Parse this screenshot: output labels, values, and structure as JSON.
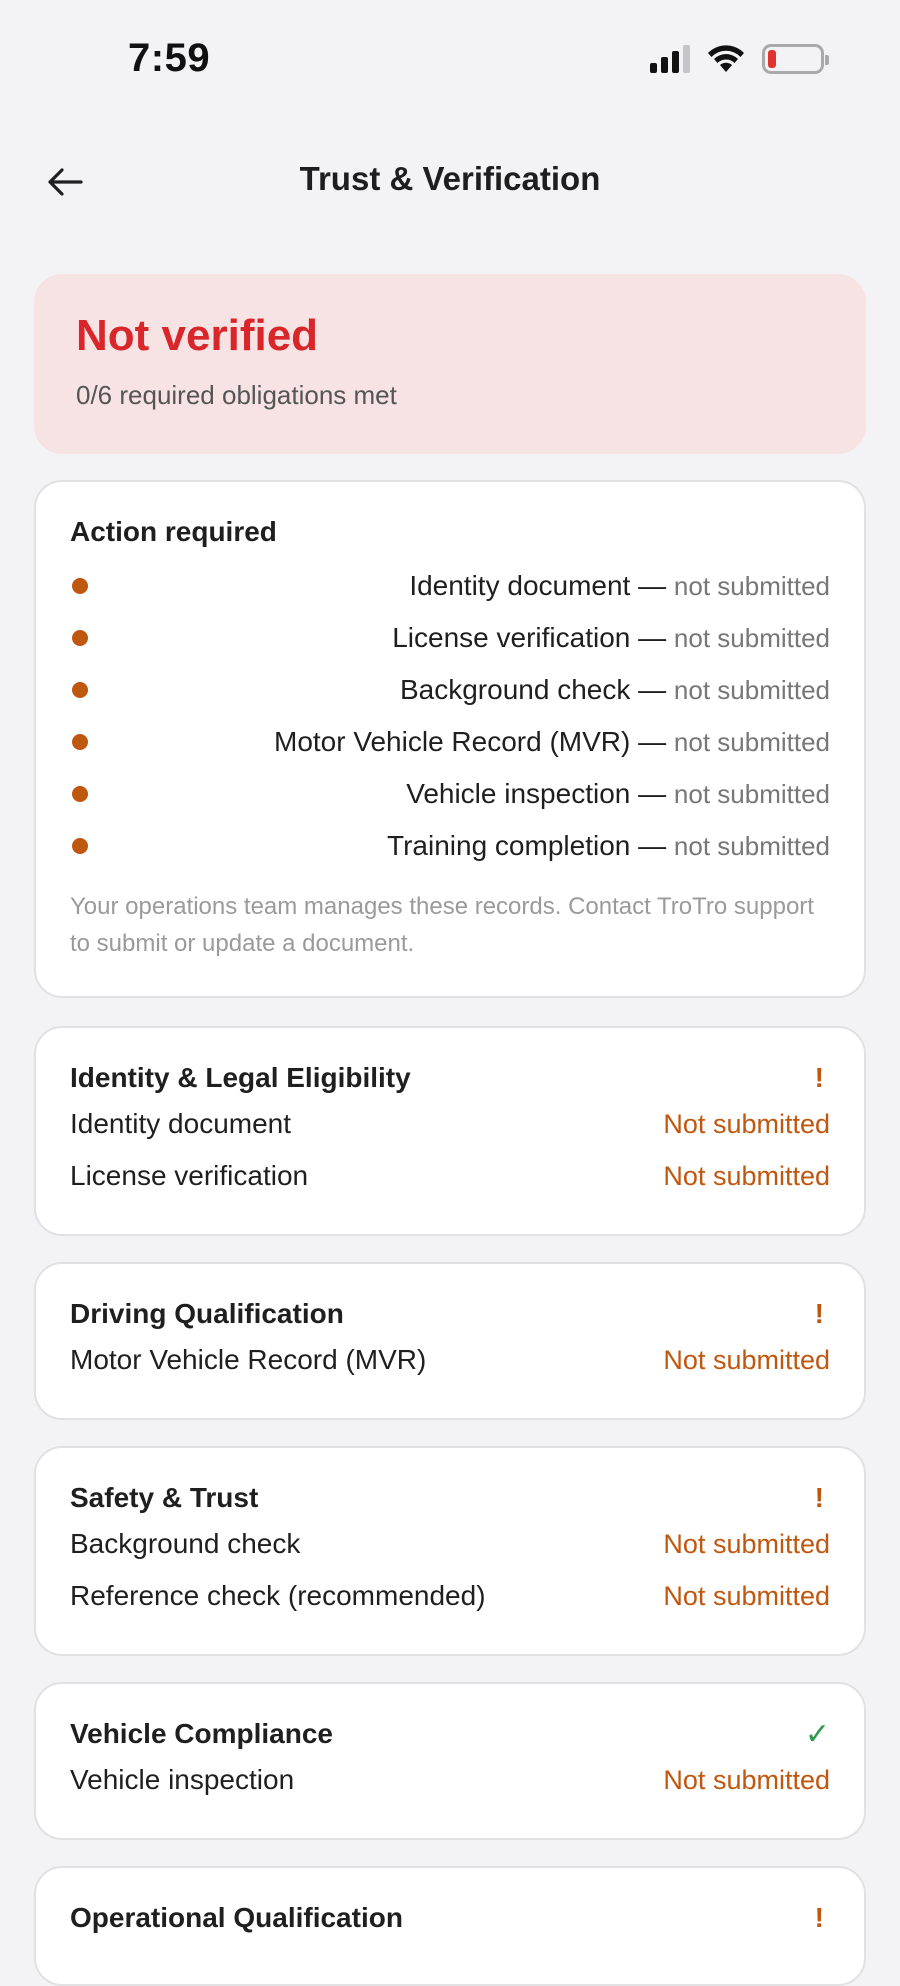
{
  "status_bar": {
    "time": "7:59"
  },
  "header": {
    "title": "Trust & Verification",
    "back_icon": "arrow-left-icon"
  },
  "banner": {
    "title": "Not verified",
    "subtitle": "0/6 required obligations met",
    "color": "#d8262b",
    "background": "#f7e3e4"
  },
  "action_card": {
    "title": "Action required",
    "separator": " — ",
    "items": [
      {
        "label": "Identity document",
        "status": "not submitted"
      },
      {
        "label": "License verification",
        "status": "not submitted"
      },
      {
        "label": "Background check",
        "status": "not submitted"
      },
      {
        "label": "Motor Vehicle Record (MVR)",
        "status": "not submitted"
      },
      {
        "label": "Vehicle inspection",
        "status": "not submitted"
      },
      {
        "label": "Training completion",
        "status": "not submitted"
      }
    ],
    "note": "Your operations team manages these records. Contact TroTro support to submit or update a document."
  },
  "categories": [
    {
      "title": "Identity & Legal Eligibility",
      "indicator": "!",
      "items": [
        {
          "name": "Identity document",
          "status": "Not submitted"
        },
        {
          "name": "License verification",
          "status": "Not submitted"
        }
      ]
    },
    {
      "title": "Driving Qualification",
      "indicator": "!",
      "items": [
        {
          "name": "Motor Vehicle Record (MVR)",
          "status": "Not submitted"
        }
      ]
    },
    {
      "title": "Safety & Trust",
      "indicator": "!",
      "items": [
        {
          "name": "Background check",
          "status": "Not submitted"
        },
        {
          "name": "Reference check (recommended)",
          "status": "Not submitted"
        }
      ]
    },
    {
      "title": "Vehicle Compliance",
      "indicator": "✓",
      "items": [
        {
          "name": "Vehicle inspection",
          "status": "Not submitted"
        }
      ]
    },
    {
      "title": "Operational Qualification",
      "indicator": "!",
      "items": []
    }
  ],
  "colors": {
    "warning": "#c0570f",
    "success": "#2e9a4b",
    "error": "#d8262b"
  }
}
